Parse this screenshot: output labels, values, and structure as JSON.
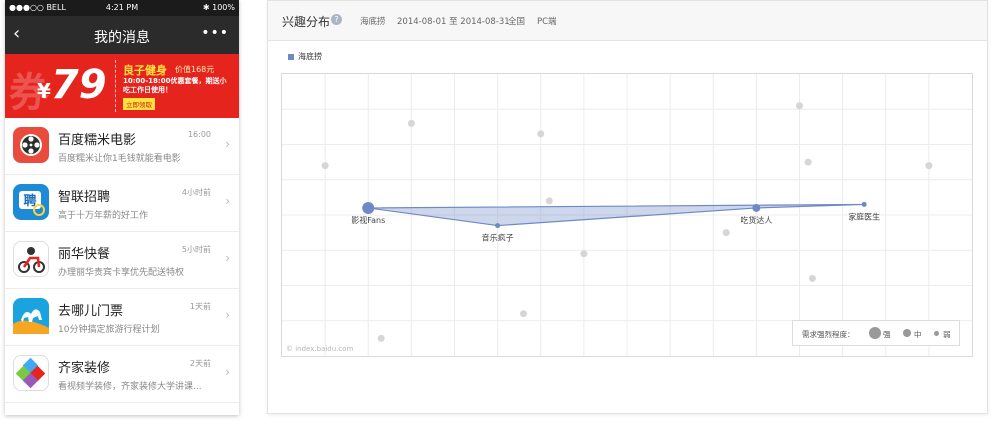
{
  "phone": {
    "status": {
      "carrier": "●●●○○ BELL",
      "time": "4:21 PM",
      "battery": "✱ 100%"
    },
    "nav": {
      "back_icon": "‹",
      "title": "我的消息",
      "more_icon": "•••"
    },
    "coupon": {
      "watermark": "券",
      "currency": "¥",
      "amount": "79",
      "brand": "良子健身",
      "price": "价值168元",
      "desc": "10:00-18:00优惠套餐，期送小吃工作日使用！",
      "claim": "立即领取"
    },
    "messages": [
      {
        "name": "百度糯米电影",
        "time": "16:00",
        "sub": "百度糯米让你1毛钱就能看电影",
        "icon": "film-reel-icon"
      },
      {
        "name": "智联招聘",
        "time": "4小时前",
        "sub": "高于十万年薪的好工作",
        "icon": "zhilian-icon"
      },
      {
        "name": "丽华快餐",
        "time": "5小时前",
        "sub": "办理丽华贵宾卡享优先配送特权",
        "icon": "delivery-rider-icon"
      },
      {
        "name": "去哪儿门票",
        "time": "1天前",
        "sub": "10分钟搞定旅游行程计划",
        "icon": "camel-icon"
      },
      {
        "name": "齐家装修",
        "time": "2天前",
        "sub": "看视频学装修，齐家装修大学讲课...",
        "icon": "qijia-logo-icon"
      }
    ],
    "chevron": "›"
  },
  "panel": {
    "title": "兴趣分布",
    "help": "?",
    "keyword": "海底捞",
    "date_range": "2014-08-01 至 2014-08-31",
    "region": "全国",
    "platform": "PC端",
    "legend": "海底捞",
    "watermark": "© index.baidu.com",
    "strength": {
      "label": "需求强烈程度：",
      "strong": "强",
      "medium": "中",
      "weak": "弱"
    }
  },
  "colors": {
    "accent": "#6f89c6",
    "coupon_red": "#e6241e",
    "coupon_yellow": "#ffe23d",
    "nav_dark": "#2b2b2b"
  },
  "chart_data": {
    "type": "scatter",
    "series": [
      {
        "name": "海底捞",
        "points": [
          {
            "label": "影视Fans",
            "x": 2,
            "y": 4.2,
            "strength": "strong"
          },
          {
            "label": "音乐疯子",
            "x": 5,
            "y": 3.7,
            "strength": "weak"
          },
          {
            "label": "吃货达人",
            "x": 11,
            "y": 4.2,
            "strength": "medium"
          },
          {
            "label": "家庭医生",
            "x": 13.5,
            "y": 4.3,
            "strength": "weak"
          }
        ]
      }
    ],
    "background_points": [
      [
        3,
        6.6
      ],
      [
        6,
        6.3
      ],
      [
        1,
        5.4
      ],
      [
        12,
        7.1
      ],
      [
        12.2,
        5.5
      ],
      [
        15,
        5.4
      ],
      [
        16.5,
        4.9
      ],
      [
        6.2,
        4.4
      ],
      [
        10.3,
        3.5
      ],
      [
        7,
        2.9
      ],
      [
        12.3,
        2.2
      ],
      [
        5.6,
        1.2
      ],
      [
        2.3,
        0.5
      ]
    ],
    "grid": true,
    "xlim": [
      0,
      16
    ],
    "ylim": [
      0,
      8
    ],
    "legend": "top-left"
  }
}
